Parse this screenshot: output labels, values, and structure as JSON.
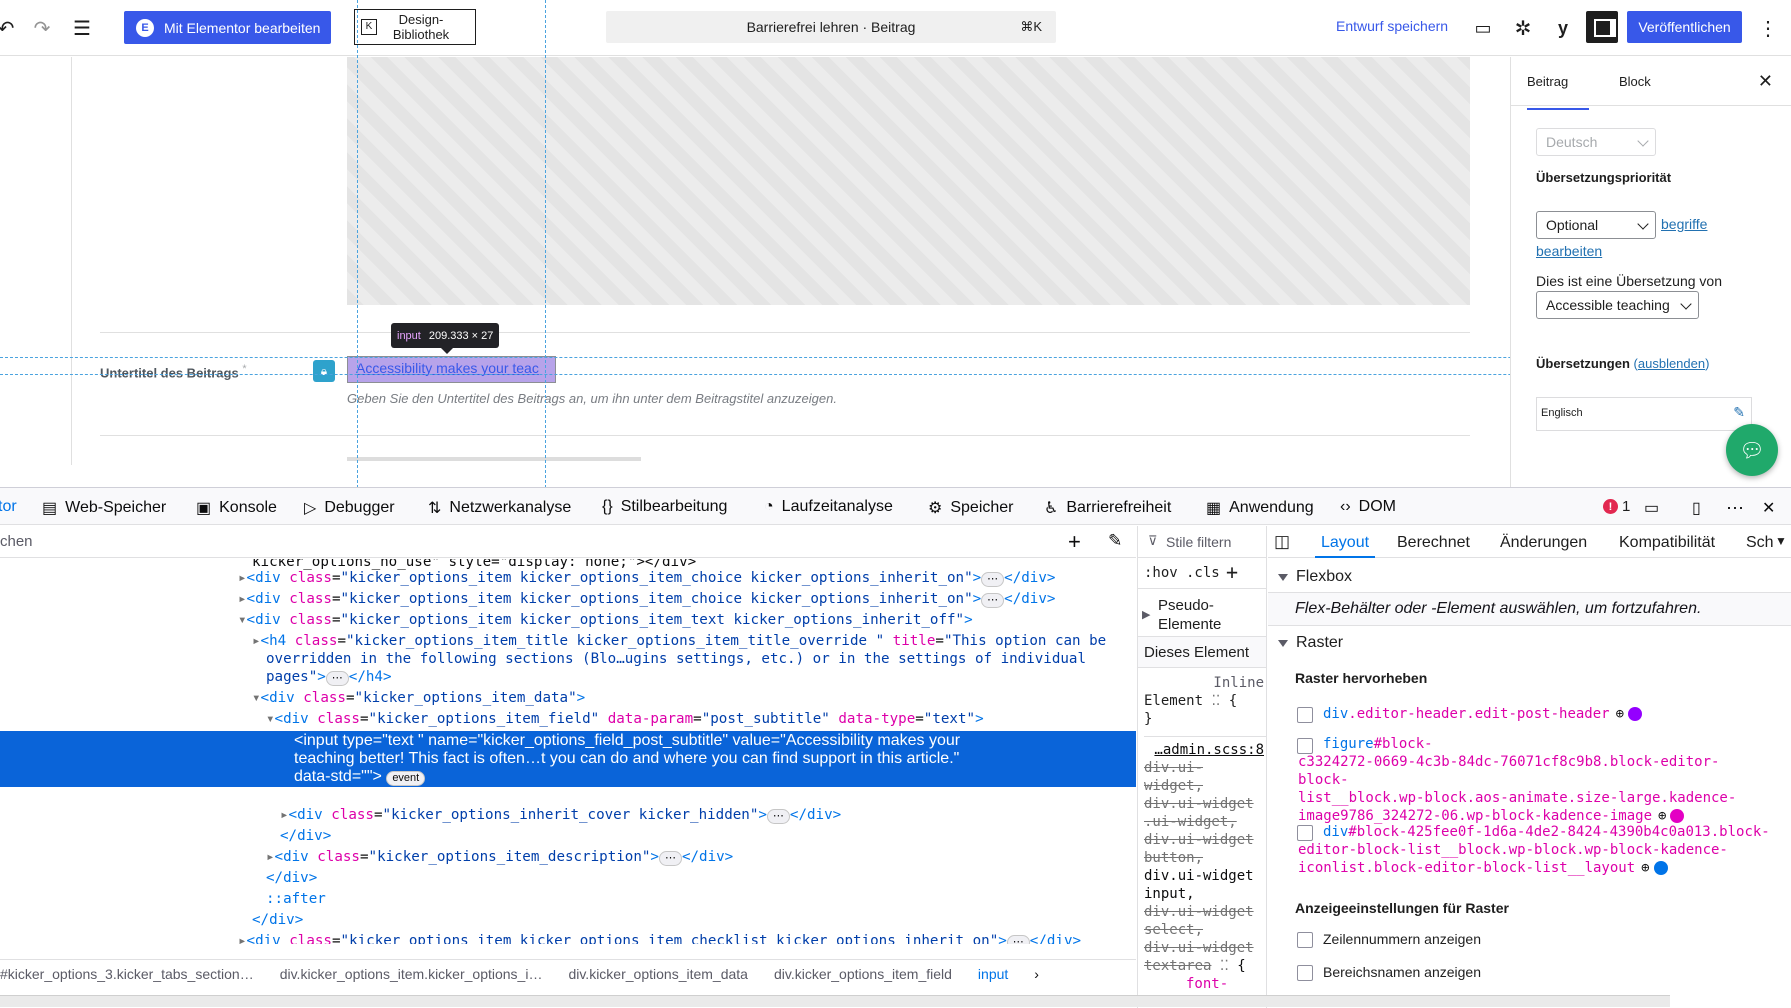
{
  "topbar": {
    "elementor_label": "Mit Elementor bearbeiten",
    "design_library_label": "Design-\nBibliothek",
    "command_title": "Barrierefrei lehren · Beitrag",
    "command_shortcut": "⌘K",
    "save_draft_label": "Entwurf speichern",
    "publish_label": "Veröffentlichen"
  },
  "canvas": {
    "tooltip_tag": "input",
    "tooltip_size": "209.333 × 27",
    "subtitle_label": "Untertitel des Beitrags",
    "subtitle_required": "*",
    "subtitle_value": "Accessibility makes your teac",
    "subtitle_description": "Geben Sie den Untertitel des Beitrags an, um ihn unter dem Beitragstitel anzuzeigen."
  },
  "sidebar": {
    "tab_post": "Beitrag",
    "tab_block": "Block",
    "language_value": "Deutsch",
    "priority_label": "Übersetzungspriorität",
    "priority_value": "Optional",
    "terms_link_1": "begriffe",
    "terms_link_2": "bearbeiten",
    "translation_of_label": "Dies ist eine Übersetzung von",
    "translation_of_value": "Accessible teaching",
    "translations_label": "Übersetzungen",
    "translations_hide_prefix": "(",
    "translations_hide_link": "ausblenden",
    "translations_hide_suffix": ")",
    "english_label": "Englisch"
  },
  "devtools": {
    "tabs": [
      "tor",
      "Web-Speicher",
      "Konsole",
      "Debugger",
      "Netzwerkanalyse",
      "Stilbearbeitung",
      "Laufzeitanalyse",
      "Speicher",
      "Barrierefreiheit",
      "Anwendung",
      "DOM"
    ],
    "error_count": "1",
    "search_placeholder": "chen",
    "markup": {
      "l0": "kicker_options_no_use\" style=\"display: none;\">",
      "l0_end": "</div>",
      "choice_class": "kicker_options_item kicker_options_item_choice kicker_options_inherit_on",
      "text_class": "kicker_options_item kicker_options_item_text kicker_options_inherit_off",
      "h4_class": "kicker_options_item_title kicker_options_item_title_override ",
      "h4_title_1": "\"This option can be",
      "h4_title_2": "overridden in the following sections (Blo…ugins settings, etc.) or in the settings of individual",
      "h4_title_3": "pages\"",
      "data_class": "kicker_options_item_data",
      "field_class": "kicker_options_item_field",
      "field_param": "post_subtitle",
      "field_type": "text",
      "input_line_1": "<input type=\"text \" name=\"kicker_options_field_post_subtitle\" value=\"Accessibility makes your",
      "input_line_2": "teaching better! This fact is often…t you can do and where you can find support in this article.\"",
      "input_line_3": "data-std=\"\">",
      "event_badge": "event",
      "cover_class": "kicker_options_inherit_cover kicker_hidden",
      "desc_class": "kicker_options_item_description",
      "after": "::after",
      "checklist_class": "kicker_options_item kicker_options_item_checklist kicker_options_inherit_on",
      "ellipsis": "⋯"
    },
    "breadcrumbs": [
      "#kicker_options_3.kicker_tabs_section…",
      "div.kicker_options_item.kicker_options_i…",
      "div.kicker_options_item_data",
      "div.kicker_options_item_field",
      "input"
    ],
    "rules": {
      "filter_placeholder": "Stile filtern",
      "hov": ":hov",
      "cls": ".cls",
      "pseudo_line_1": "Pseudo-",
      "pseudo_line_2": "Elemente",
      "this_element": "Dieses Element",
      "inline": "Inline",
      "element_word": "Element",
      "brace_open": "{",
      "brace_close": "}",
      "source_link": "…admin.scss:8",
      "selectors": [
        "div.ui-",
        "widget,",
        "div.ui-widget",
        ".ui-widget,",
        "div.ui-widget",
        "button,",
        "div.ui-widget",
        "input,",
        "div.ui-widget",
        "select,",
        "div.ui-widget",
        "textarea"
      ],
      "font_prop": "font-"
    },
    "layout": {
      "tabs": [
        "Layout",
        "Berechnet",
        "Änderungen",
        "Kompatibilität",
        "Sch"
      ],
      "flexbox_heading": "Flexbox",
      "flexbox_hint": "Flex-Behälter oder -Element auswählen, um fortzufahren.",
      "grid_heading": "Raster",
      "highlight_heading": "Raster hervorheben",
      "grid_items": [
        {
          "tag": "div",
          "rest": ".editor-header.edit-post-header",
          "color": "#9400ff"
        },
        {
          "tag": "figure",
          "rest": "#block-\nc3324272-0669-4c3b-84dc-76071cf8c9b8.block-editor-block-\nlist__block.wp-block.aos-animate.size-large.kadence-\nimage9786_324272-06.wp-block-kadence-image",
          "color": "#e400c4"
        },
        {
          "tag": "div",
          "rest": "#block-425fee0f-1d6a-4de2-8424-4390b4c0a013.block-\neditor-block-list__block.wp-block.wp-block-kadence-\niconlist.block-editor-block-list__layout",
          "color": "#0074e8"
        }
      ],
      "display_heading": "Anzeigeeinstellungen für Raster",
      "opt_line_numbers": "Zeilennummern anzeigen",
      "opt_area_names": "Bereichsnamen anzeigen"
    }
  }
}
